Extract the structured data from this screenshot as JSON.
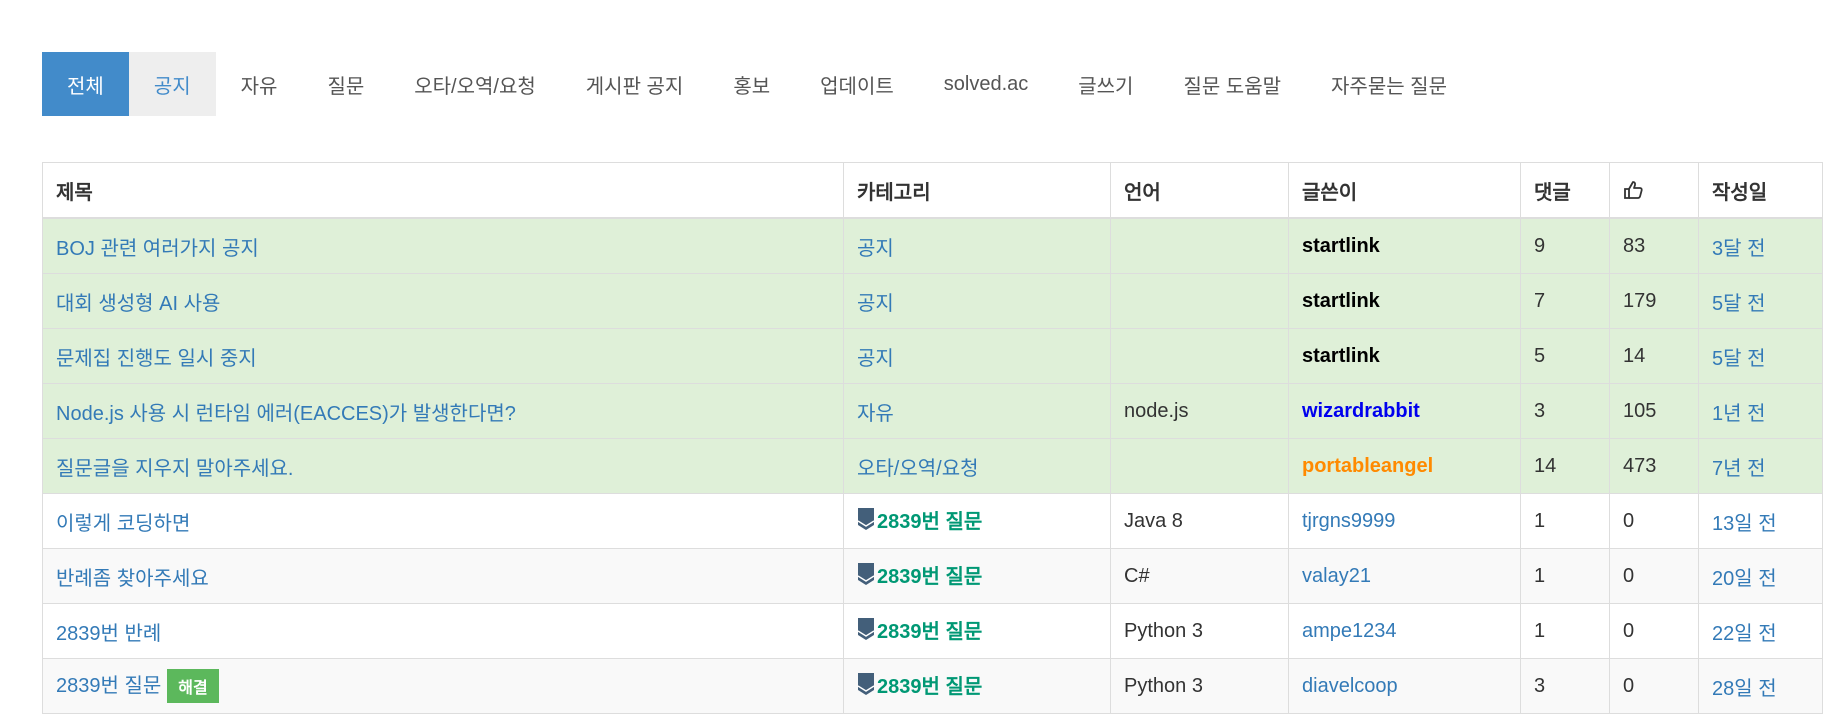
{
  "tabs": [
    {
      "label": "전체",
      "state": "active"
    },
    {
      "label": "공지",
      "state": "hover"
    },
    {
      "label": "자유",
      "state": ""
    },
    {
      "label": "질문",
      "state": ""
    },
    {
      "label": "오타/오역/요청",
      "state": ""
    },
    {
      "label": "게시판 공지",
      "state": ""
    },
    {
      "label": "홍보",
      "state": ""
    },
    {
      "label": "업데이트",
      "state": ""
    },
    {
      "label": "solved.ac",
      "state": ""
    },
    {
      "label": "글쓰기",
      "state": ""
    },
    {
      "label": "질문 도움말",
      "state": ""
    },
    {
      "label": "자주묻는 질문",
      "state": ""
    }
  ],
  "table": {
    "headers": {
      "title": "제목",
      "category": "카테고리",
      "language": "언어",
      "author": "글쓴이",
      "comments": "댓글",
      "likes_icon": "thumbs-up-icon",
      "date": "작성일"
    },
    "rows": [
      {
        "title": "BOJ 관련 여러가지 공지",
        "solved": "",
        "category": "공지",
        "problem_tier": "",
        "language": "",
        "author": "startlink",
        "author_color": "black",
        "comments": "9",
        "likes": "83",
        "date": "3달 전",
        "row_style": "notice"
      },
      {
        "title": "대회 생성형 AI 사용",
        "solved": "",
        "category": "공지",
        "problem_tier": "",
        "language": "",
        "author": "startlink",
        "author_color": "black",
        "comments": "7",
        "likes": "179",
        "date": "5달 전",
        "row_style": "notice"
      },
      {
        "title": "문제집 진행도 일시 중지",
        "solved": "",
        "category": "공지",
        "problem_tier": "",
        "language": "",
        "author": "startlink",
        "author_color": "black",
        "comments": "5",
        "likes": "14",
        "date": "5달 전",
        "row_style": "notice"
      },
      {
        "title": "Node.js 사용 시 런타임 에러(EACCES)가 발생한다면?",
        "solved": "",
        "category": "자유",
        "problem_tier": "",
        "language": "node.js",
        "author": "wizardrabbit",
        "author_color": "blue",
        "comments": "3",
        "likes": "105",
        "date": "1년 전",
        "row_style": "notice"
      },
      {
        "title": "질문글을 지우지 말아주세요.",
        "solved": "",
        "category": "오타/오역/요청",
        "problem_tier": "",
        "language": "",
        "author": "portableangel",
        "author_color": "orange",
        "comments": "14",
        "likes": "473",
        "date": "7년 전",
        "row_style": "notice"
      },
      {
        "title": "이렇게 코딩하면",
        "solved": "",
        "category": "2839번 질문",
        "problem_tier": "4",
        "language": "Java 8",
        "author": "tjrgns9999",
        "author_color": "link",
        "comments": "1",
        "likes": "0",
        "date": "13일 전",
        "row_style": "plain"
      },
      {
        "title": "반례좀 찾아주세요",
        "solved": "",
        "category": "2839번 질문",
        "problem_tier": "4",
        "language": "C#",
        "author": "valay21",
        "author_color": "link",
        "comments": "1",
        "likes": "0",
        "date": "20일 전",
        "row_style": "striped"
      },
      {
        "title": "2839번 반례",
        "solved": "",
        "category": "2839번 질문",
        "problem_tier": "4",
        "language": "Python 3",
        "author": "ampe1234",
        "author_color": "link",
        "comments": "1",
        "likes": "0",
        "date": "22일 전",
        "row_style": "plain"
      },
      {
        "title": "2839번 질문",
        "solved": "해결",
        "category": "2839번 질문",
        "problem_tier": "4",
        "language": "Python 3",
        "author": "diavelcoop",
        "author_color": "link",
        "comments": "3",
        "likes": "0",
        "date": "28일 전",
        "row_style": "striped"
      }
    ]
  },
  "colors": {
    "active_tab": "#428bca",
    "notice_row": "#dff0d8",
    "link": "#337ab7",
    "problem_green": "#009874",
    "solved_badge": "#5cb85c",
    "tier_badge": "#435f7a"
  }
}
